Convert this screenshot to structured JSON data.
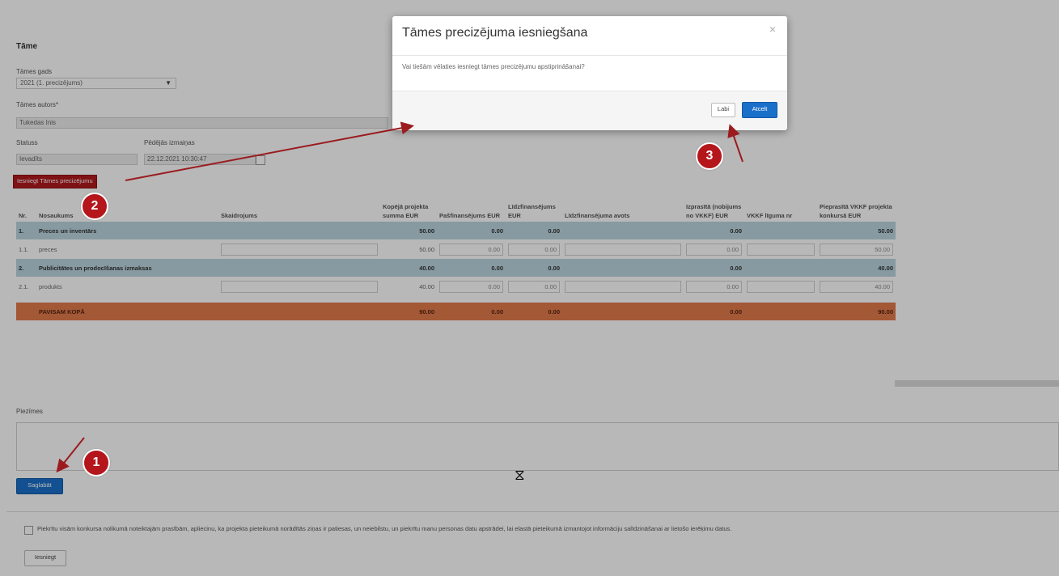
{
  "form": {
    "title": "Tāme",
    "year_label": "Tāmes gads",
    "year_value": "2021 (1. precizējums)",
    "author_label": "Tāmes autors*",
    "author_value": "Tukedas Inis",
    "status_label": "Statuss",
    "status_value": "Ievadīts",
    "date_label": "Pēdējās izmaiņas",
    "date_value": "22.12.2021 10:30:47",
    "submit_update_label": "Iesniegt Tāmes precizējumu"
  },
  "table": {
    "headers": {
      "nr": "Nr.",
      "name": "Nosaukums",
      "explanation": "Skaidrojums",
      "total": "Kopējā projekta summa EUR",
      "self_funding": "Pašfinansējums EUR",
      "co_funding": "Līdzfinansējums EUR",
      "co_funding_source": "Līdzfinansējuma avots",
      "requested": "Izprasītā (nobijums no VKKF) EUR",
      "vkkf_funding": "VKKF līguma nr",
      "vkkf_competition": "Pieprasītā VKKF projekta konkursā EUR"
    },
    "rows": [
      {
        "type": "cat",
        "nr": "1.",
        "name": "Preces un inventārs",
        "total": "50.00",
        "self": "0.00",
        "co": "0.00",
        "req": "0.00",
        "comp": "50.00"
      },
      {
        "type": "item",
        "nr": "1.1.",
        "name": "preces",
        "total": "50.00",
        "self": "0.00",
        "co": "0.00",
        "req": "0.00",
        "comp": "50.00"
      },
      {
        "type": "cat",
        "nr": "2.",
        "name": "Publicitātes un prodocīšanas izmaksas",
        "total": "40.00",
        "self": "0.00",
        "co": "0.00",
        "req": "0.00",
        "comp": "40.00"
      },
      {
        "type": "item",
        "nr": "2.1.",
        "name": "produkts",
        "total": "40.00",
        "self": "0.00",
        "co": "0.00",
        "req": "0.00",
        "comp": "40.00"
      },
      {
        "type": "total",
        "nr": "",
        "name": "PAVISAM KOPĀ",
        "total": "90.00",
        "self": "0.00",
        "co": "0.00",
        "req": "0.00",
        "comp": "90.00"
      }
    ]
  },
  "notes_label": "Piezīmes",
  "save_label": "Saglabāt",
  "consent_text": "Piekrītu visām konkursa nolikumā noteiktajām prasībām, apliecinu, ka projekta pieteikumā norādītās ziņas ir patiesas, un neiebilstu, un piekrītu manu personas datu apstrādei, lai elastā pieteikumā izmantojot informāciju salīdzināšanai ar lietošo ierēķimu datus.",
  "submit_label": "Iesniegt",
  "modal": {
    "title": "Tāmes precizējuma iesniegšana",
    "close": "×",
    "body": "Vai tiešām vēlaties iesniegt tāmes precizējumu apstiprināšanai?",
    "cancel": "Labi",
    "confirm": "Atcelt"
  },
  "markers": [
    "1",
    "2",
    "3"
  ],
  "colors": {
    "marker_red": "#b4161b",
    "category_row": "#bcd6e0",
    "total_row": "#e27b4c",
    "primary_button": "#1a6fc9"
  }
}
